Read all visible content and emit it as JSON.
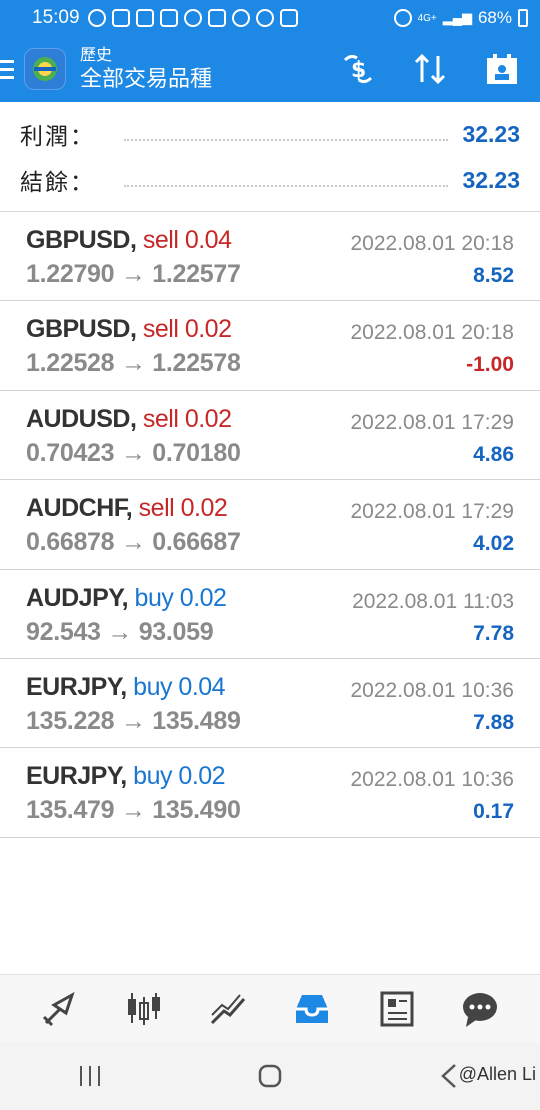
{
  "status_bar": {
    "time": "15:09",
    "battery": "68%",
    "network": "4G+"
  },
  "app_bar": {
    "title_small": "歷史",
    "title_large": "全部交易品種",
    "actions": [
      "currency-exchange-icon",
      "sort-icon",
      "calendar-icon"
    ]
  },
  "summary": {
    "profit_label": "利潤：",
    "profit_value": "32.23",
    "balance_label": "結餘：",
    "balance_value": "32.23"
  },
  "trades": [
    {
      "symbol": "GBPUSD,",
      "side": "sell 0.04",
      "type": "sell",
      "open": "1.22790",
      "close": "1.22577",
      "time": "2022.08.01 20:18",
      "profit": "8.52"
    },
    {
      "symbol": "GBPUSD,",
      "side": "sell 0.02",
      "type": "sell",
      "open": "1.22528",
      "close": "1.22578",
      "time": "2022.08.01 20:18",
      "profit": "-1.00"
    },
    {
      "symbol": "AUDUSD,",
      "side": "sell 0.02",
      "type": "sell",
      "open": "0.70423",
      "close": "0.70180",
      "time": "2022.08.01 17:29",
      "profit": "4.86"
    },
    {
      "symbol": "AUDCHF,",
      "side": "sell 0.02",
      "type": "sell",
      "open": "0.66878",
      "close": "0.66687",
      "time": "2022.08.01 17:29",
      "profit": "4.02"
    },
    {
      "symbol": "AUDJPY,",
      "side": "buy 0.02",
      "type": "buy",
      "open": "92.543",
      "close": "93.059",
      "time": "2022.08.01 11:03",
      "profit": "7.78"
    },
    {
      "symbol": "EURJPY,",
      "side": "buy 0.04",
      "type": "buy",
      "open": "135.228",
      "close": "135.489",
      "time": "2022.08.01 10:36",
      "profit": "7.88"
    },
    {
      "symbol": "EURJPY,",
      "side": "buy 0.02",
      "type": "buy",
      "open": "135.479",
      "close": "135.490",
      "time": "2022.08.01 10:36",
      "profit": "0.17"
    }
  ],
  "arrow": "→",
  "bottom_nav": [
    "trade-icon",
    "chart-icon",
    "trend-icon",
    "history-inbox-icon",
    "news-icon",
    "chat-icon"
  ],
  "active_nav": "history-inbox-icon",
  "watermark": "@Allen Li",
  "colors": {
    "accent": "#1e88e5",
    "sell": "#c62828",
    "buy": "#1976d2",
    "profit": "#1565c0"
  }
}
